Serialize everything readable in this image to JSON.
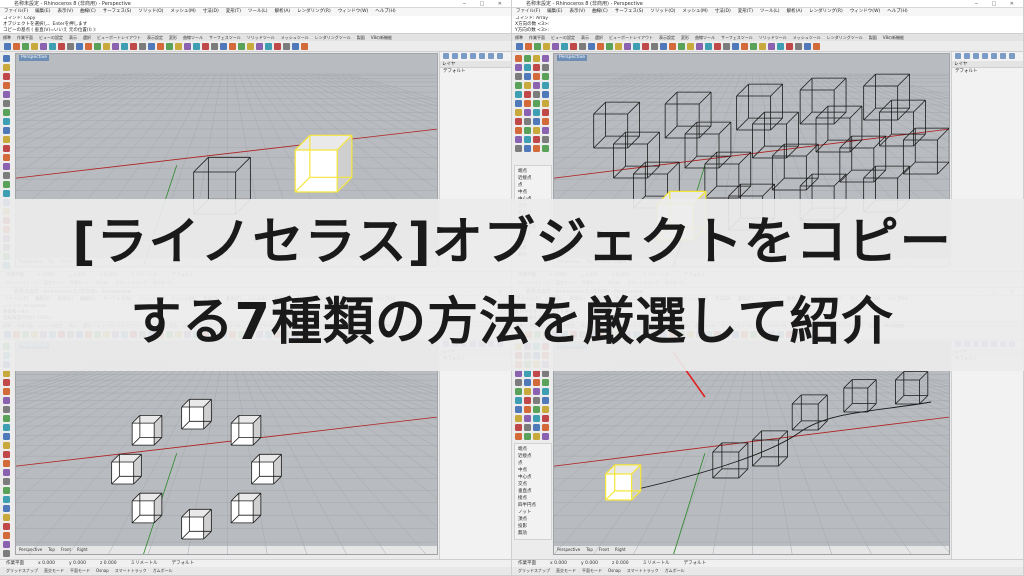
{
  "windows": [
    {
      "id": "top-left",
      "title": "名称未設定 - Rhinoceros 8 (非商用) - Perspective",
      "command_lines": [
        "コマンド: Copy",
        "オブジェクトを選択し、Enterを押します",
        "コピーの基点 ( 垂直(V)=いいえ 元の位置(I) ):"
      ],
      "viewport_label": "Perspective",
      "layer_panel": {
        "header": "レイヤ",
        "row": "デフォルト"
      }
    },
    {
      "id": "top-right",
      "title": "名称未設定 - Rhinoceros 8 (非商用) - Perspective",
      "command_lines": [
        "コマンド: Array",
        "X方向の数 <3>:",
        "Y方向の数 <3>:"
      ],
      "viewport_label": "Perspective",
      "layer_panel": {
        "header": "レイヤ",
        "row": "デフォルト"
      }
    },
    {
      "id": "bottom-left",
      "title": "名称未設定 - Rhinoceros 8 (非商用) - Perspective",
      "command_lines": [
        "コマンド: ArrayPolar",
        "要素数 <8>:",
        "回転角度の合計 <360>:"
      ],
      "viewport_label": "Perspective",
      "layer_panel": {
        "header": "レイヤ",
        "row": "デフォルト"
      }
    },
    {
      "id": "bottom-right",
      "title": "名称未設定 - Rhinoceros 8 (非商用) - Perspective",
      "command_lines": [
        "コマンド: ArrayCrv",
        "配列するオブジェクトを選択",
        "パス曲線を選択"
      ],
      "viewport_label": "Perspective",
      "layer_panel": {
        "header": "レイヤ",
        "row": "デフォルト"
      }
    }
  ],
  "menu_items": [
    "ファイル(F)",
    "編集(E)",
    "表示(V)",
    "曲線(C)",
    "サーフェス(S)",
    "ソリッド(O)",
    "メッシュ(M)",
    "寸法(D)",
    "変形(T)",
    "ツール(L)",
    "解析(A)",
    "レンダリング(R)",
    "ウィンドウ(W)",
    "ヘルプ(H)"
  ],
  "toolbar_tabs": [
    "標準",
    "作業平面",
    "ビューの設定",
    "表示",
    "選択",
    "ビューポートレイアウト",
    "表示設定",
    "変形",
    "曲線ツール",
    "サーフェスツール",
    "ソリッドツール",
    "メッシュツール",
    "レンダリングツール",
    "製図",
    "V8の新機能"
  ],
  "viewport_tabs": [
    "Perspective",
    "Top",
    "Front",
    "Right"
  ],
  "status_items": [
    "作業平面",
    "x 0.000",
    "y 0.000",
    "z 0.000",
    "ミリメートル",
    "デフォルト",
    "グリッドスナップ",
    "直交モード",
    "平面モード",
    "Osnap",
    "スマートトラック",
    "ガムボール"
  ],
  "osnap_items": [
    "端点",
    "近接点",
    "点",
    "中点",
    "中心点",
    "交点",
    "垂直点",
    "接点",
    "四半円点",
    "ノット",
    "頂点",
    "投影",
    "無効"
  ],
  "banner": {
    "line1": "[ライノセラス]オブジェクトをコピー",
    "line2": "する7種類の方法を厳選して紹介"
  },
  "colors": {
    "viewport_bg": "#b8bbbf",
    "selection": "#f5e63a",
    "grid_x_axis": "#b02020",
    "grid_y_axis": "#2a8a2a",
    "arrow": "#e02020"
  }
}
